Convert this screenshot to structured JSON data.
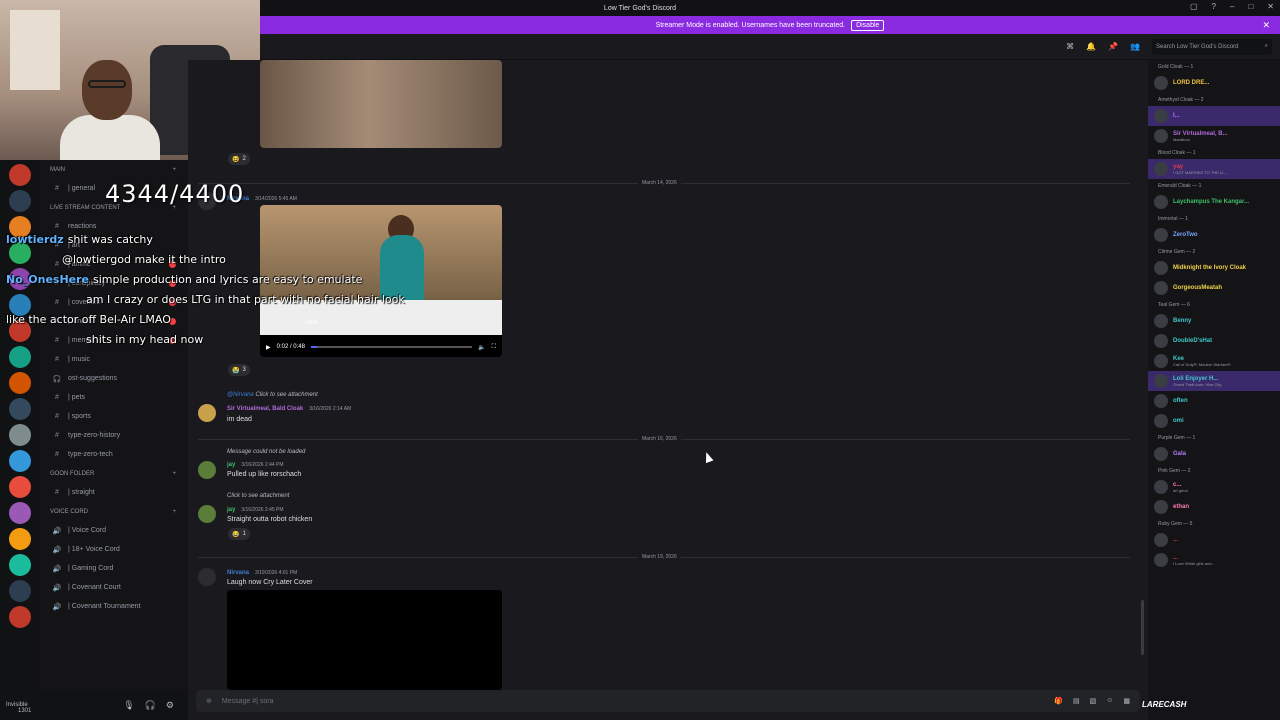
{
  "window": {
    "title": "Low Tier God's Discord"
  },
  "banner": {
    "text": "Streamer Mode is enabled. Usernames have been truncated.",
    "button": "Disable"
  },
  "topbar": {
    "search_placeholder": "Search Low Tier God's Discord"
  },
  "stream_overlay": {
    "counter": "4344/4400",
    "chat": [
      {
        "user": "lowtierdz",
        "text": "shit was catchy"
      },
      {
        "user": "",
        "text": "@lowtiergod make it the intro"
      },
      {
        "user": "No_OnesHere",
        "text": "simple production and lyrics are easy to emulate"
      },
      {
        "user": "",
        "text": "am I crazy or does LTG in that part with no facial hair look"
      },
      {
        "user": "",
        "text": "like the actor off Bel-Air LMAO"
      },
      {
        "user": "",
        "text": "shits in my head now"
      }
    ],
    "watermark": "LARECASH"
  },
  "channels": {
    "categories": {
      "main": "MAIN",
      "live": "LIVE STREAM CONTENT",
      "goon": "GOON FOLDER",
      "voice": "VOICE CORD"
    },
    "items": [
      {
        "label": "| general",
        "badge": false
      },
      {
        "label": "reactions",
        "badge": false
      },
      {
        "label": "| art",
        "badge": false
      },
      {
        "label": "| anime",
        "badge": true
      },
      {
        "label": "| conspiracy",
        "badge": true
      },
      {
        "label": "| covenant",
        "badge": true
      },
      {
        "label": "| fitness",
        "badge": true
      },
      {
        "label": "| memes",
        "badge": true
      },
      {
        "label": "| music",
        "badge": false
      },
      {
        "label": "ost-suggestions",
        "badge": false
      },
      {
        "label": "| pets",
        "badge": false
      },
      {
        "label": "| sports",
        "badge": false
      },
      {
        "label": "type-zero-history",
        "badge": false
      },
      {
        "label": "type-zero-tech",
        "badge": false
      }
    ],
    "goon_items": [
      {
        "label": "| straight"
      }
    ],
    "voice_items": [
      {
        "label": "| Voice Cord"
      },
      {
        "label": "| 18+ Voice Cord"
      },
      {
        "label": "| Gaming Cord"
      },
      {
        "label": "| Covenant Court"
      },
      {
        "label": "| Covenant Tournament"
      }
    ]
  },
  "user_panel": {
    "status": "Invisible",
    "tag": "1301"
  },
  "messages": {
    "dividers": [
      "March 14, 2026",
      "March 16, 2026",
      "March 19, 2026"
    ],
    "msg1": {
      "author": "Nirvana",
      "time": "3/14/2026 5:45 AM",
      "video_time": "0:02 / 0:48",
      "reaction_count": "3",
      "watermark": "Sora"
    },
    "reaction_top": "2",
    "msg2": {
      "reply_to": "@Nirvana",
      "reply_text": "Click to see attachment",
      "author": "Sir Virtualmeal, Bald Cloak",
      "time": "3/16/2026 2:14 AM",
      "text": "im dead"
    },
    "msg3": {
      "reply_text": "Message could not be loaded",
      "author": "jay",
      "time": "3/16/2026 2:44 PM",
      "text": "Pulled up like rorschach"
    },
    "msg4": {
      "reply_text": "Click to see attachment",
      "author": "jay",
      "time": "3/16/2026 2:45 PM",
      "text": "Straight outta robot chicken",
      "reaction_count": "1"
    },
    "msg5": {
      "author": "Nirvana",
      "time": "3/19/2026 4:01 PM",
      "text": "Laugh now Cry Later Cover"
    }
  },
  "composer": {
    "placeholder": "Message #| sora"
  },
  "members": {
    "groups": [
      {
        "role": "Gold Cloak — 1",
        "members": [
          {
            "name": "LORD DRE...",
            "color": "#f0c040",
            "sub": ""
          }
        ]
      },
      {
        "role": "Amethyst Cloak — 2",
        "members": [
          {
            "name": "I...",
            "color": "#c070ff",
            "sub": "",
            "hl": true
          },
          {
            "name": "Sir Virtualmeal, B...",
            "color": "#b06ad8",
            "sub": "Marathon"
          }
        ]
      },
      {
        "role": "Blood Cloak — 1",
        "members": [
          {
            "name": "yay",
            "color": "#e23b4b",
            "sub": "I GOT MARRIED TO THE LL...",
            "hl": true
          }
        ]
      },
      {
        "role": "Emerald Cloak — 1",
        "members": [
          {
            "name": "Laychampus The Kangar...",
            "color": "#3fbf6a",
            "sub": ""
          }
        ]
      },
      {
        "role": "Immortal — 1",
        "members": [
          {
            "name": "ZeroTwo",
            "color": "#7aa7ff",
            "sub": ""
          }
        ]
      },
      {
        "role": "Citrine Gem — 2",
        "members": [
          {
            "name": "Midknight the Ivory Cloak",
            "color": "#f0d24a",
            "sub": ""
          },
          {
            "name": "GorgeousMeatah",
            "color": "#f0d24a",
            "sub": ""
          }
        ]
      },
      {
        "role": "Teal Gem — 6",
        "members": [
          {
            "name": "Benny",
            "color": "#3fc8c8",
            "sub": ""
          },
          {
            "name": "DoubleD'sHat",
            "color": "#3fc8c8",
            "sub": ""
          },
          {
            "name": "Kee",
            "color": "#3fc8c8",
            "sub": "Call of Duty®: Modern Warfare®"
          },
          {
            "name": "Loli Enjoyer H...",
            "color": "#3fc8c8",
            "sub": "Grand Theft Auto: Vice City",
            "hl": true
          },
          {
            "name": "often",
            "color": "#3fc8c8",
            "sub": ""
          },
          {
            "name": "omi",
            "color": "#3fc8c8",
            "sub": ""
          }
        ]
      },
      {
        "role": "Purple Gem — 1",
        "members": [
          {
            "name": "Gala",
            "color": "#b57aff",
            "sub": ""
          }
        ]
      },
      {
        "role": "Pink Gem — 2",
        "members": [
          {
            "name": "c...",
            "color": "#ff7ab5",
            "sub": "art grind"
          },
          {
            "name": "ethan",
            "color": "#ff7ab5",
            "sub": ""
          }
        ]
      },
      {
        "role": "Ruby Gem — 5",
        "members": [
          {
            "name": "...",
            "color": "#e23b4b",
            "sub": ""
          },
          {
            "name": "...",
            "color": "#e23b4b",
            "sub": "I Love White girls and..."
          }
        ]
      }
    ]
  },
  "colors": {
    "accent": "#8a2be2",
    "background": "#1a1a1e",
    "sidebar": "#141417"
  }
}
